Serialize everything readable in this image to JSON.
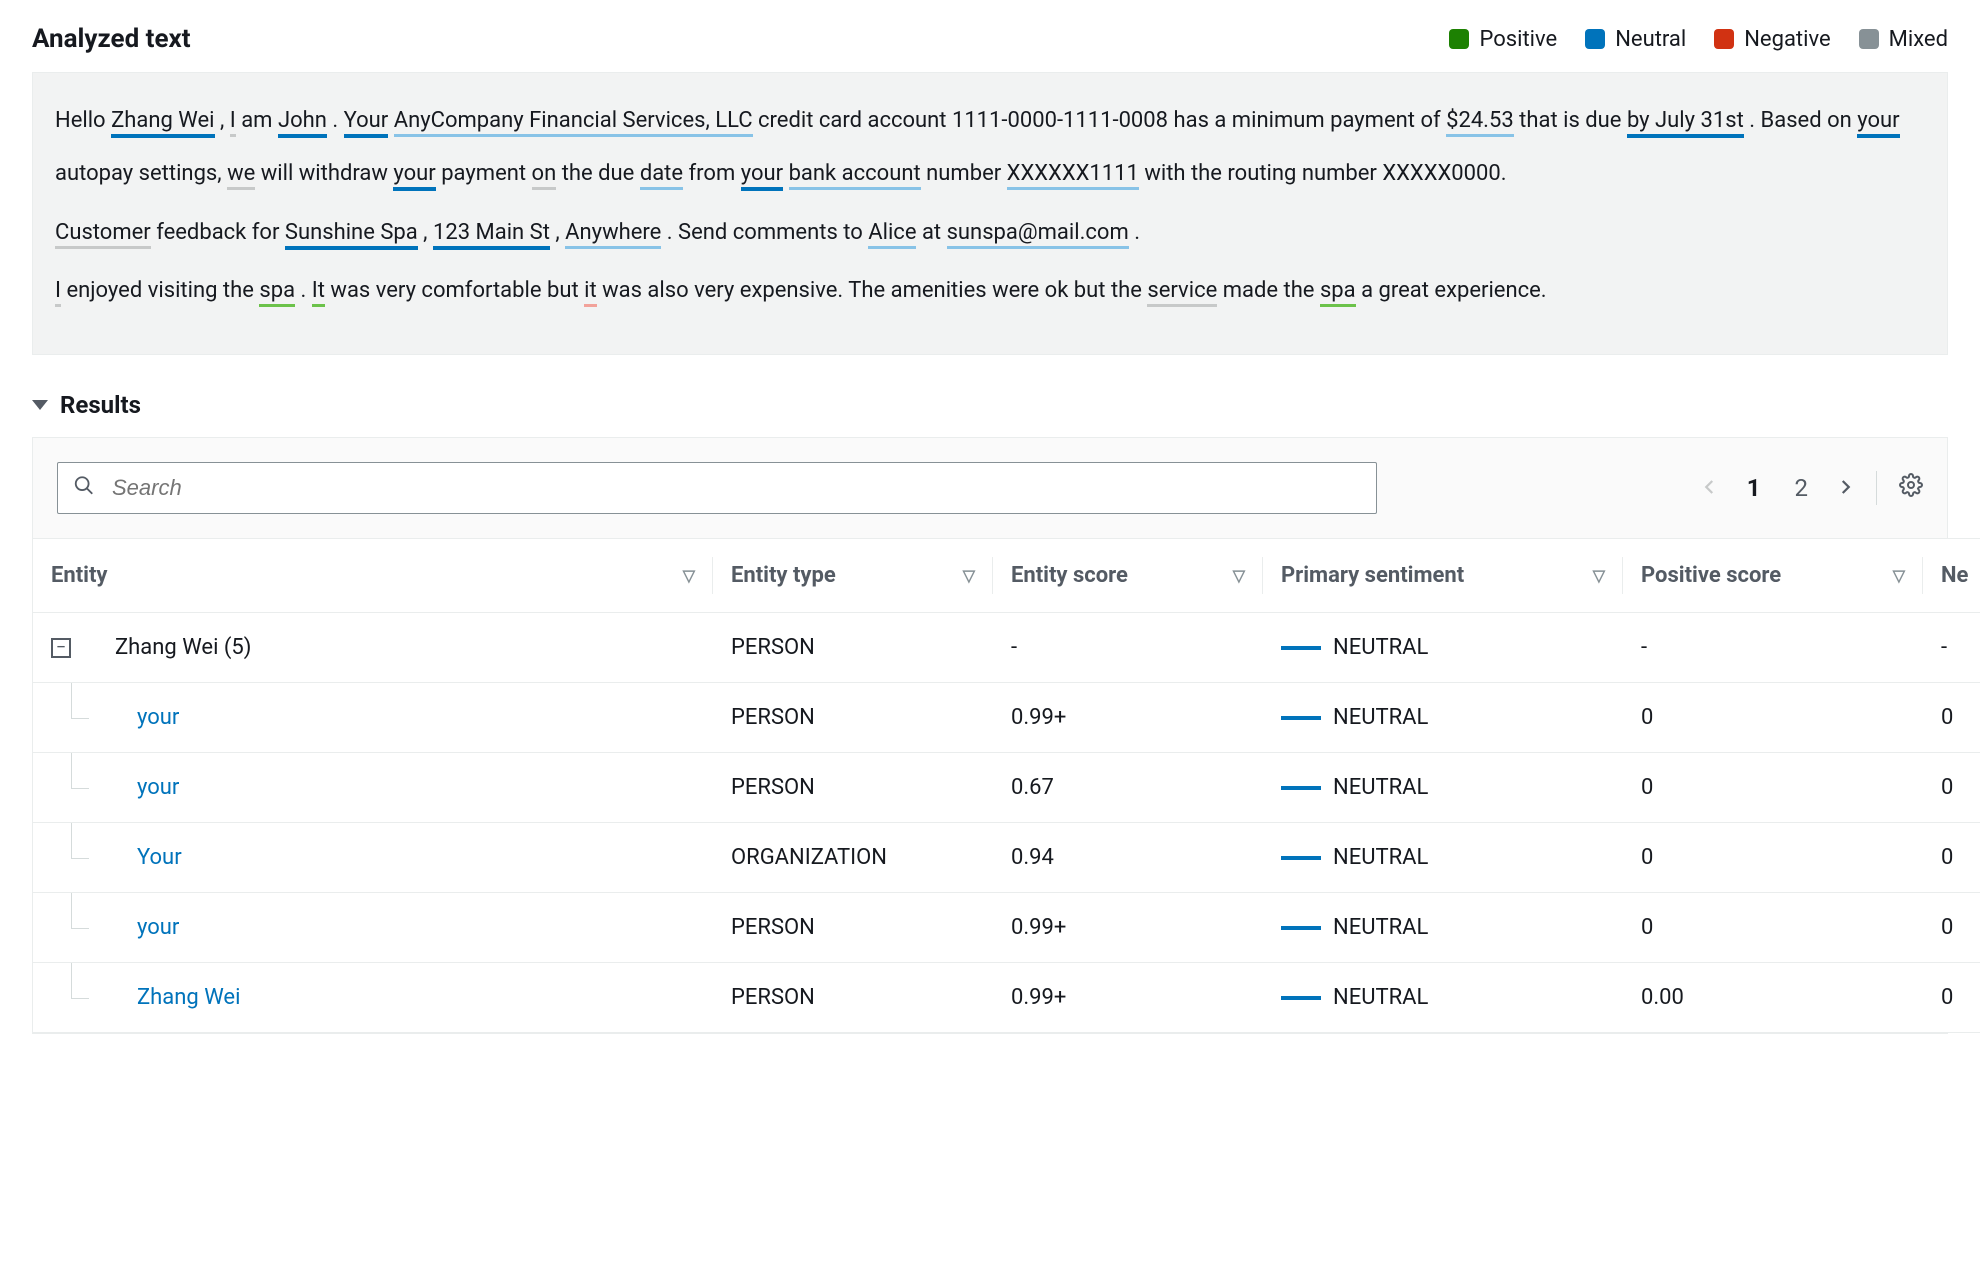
{
  "header": {
    "title": "Analyzed text"
  },
  "legend": {
    "positive": "Positive",
    "neutral": "Neutral",
    "negative": "Negative",
    "mixed": "Mixed"
  },
  "analyzed_text": {
    "p1": {
      "t0": "Hello ",
      "zhang_wei": "Zhang Wei",
      "t1": " , ",
      "i1": "I",
      "t2": " am ",
      "john": "John",
      "t3": " . ",
      "your1": "Your",
      "t4": "  ",
      "company": "AnyCompany Financial Services, LLC",
      "t5": "  credit card account  1111-0000-1111-0008 has a minimum payment of ",
      "amount": "$24.53",
      "t6": "  that is due ",
      "due": "by July 31st",
      "t7": " . Based on ",
      "your2": "your",
      "t8": "  autopay settings, ",
      "we1": "we",
      "t9": "  will withdraw ",
      "your3": "your",
      "t10": "  payment ",
      "on1": "on",
      "t11": "  the due ",
      "date1": "date",
      "t12": "  from ",
      "your4": "your",
      "t13": "  ",
      "bank_account": "bank account",
      "t14": "  number ",
      "acct_num": "XXXXXX1111",
      "t15": "  with the routing number XXXXX0000."
    },
    "p2": {
      "customer": "Customer",
      "t0": "  feedback for ",
      "spa_name": "Sunshine Spa",
      "t1": " , ",
      "addr": "123 Main St",
      "t2": " , ",
      "city": "Anywhere",
      "t3": " . Send comments to ",
      "alice": "Alice",
      "t4": "  at ",
      "email": "sunspa@mail.com",
      "t5": " ."
    },
    "p3": {
      "i1": "I",
      "t0": "  enjoyed visiting the ",
      "spa1": "spa",
      "t1": " . ",
      "it1": "It",
      "t2": "  was very comfortable but ",
      "it2": "it",
      "t3": "  was also very expensive. The amenities were ok but the ",
      "service": "service",
      "t4": "  made the ",
      "spa2": "spa",
      "t5": "  a great experience."
    }
  },
  "results": {
    "heading": "Results",
    "search_placeholder": "Search",
    "pager": {
      "page1": "1",
      "page2": "2"
    },
    "columns": {
      "entity": "Entity",
      "entity_type": "Entity type",
      "entity_score": "Entity score",
      "primary_sentiment": "Primary sentiment",
      "positive_score": "Positive score",
      "negative_score_abbrev": "Ne"
    },
    "rows": [
      {
        "indent": 0,
        "expand": "−",
        "entity": "Zhang Wei (5)",
        "link": false,
        "type": "PERSON",
        "score": "-",
        "sentiment": "NEUTRAL",
        "positive": "-",
        "negative": "-"
      },
      {
        "indent": 1,
        "entity": "your",
        "link": true,
        "type": "PERSON",
        "score": "0.99+",
        "sentiment": "NEUTRAL",
        "positive": "0",
        "negative": "0"
      },
      {
        "indent": 1,
        "entity": "your",
        "link": true,
        "type": "PERSON",
        "score": "0.67",
        "sentiment": "NEUTRAL",
        "positive": "0",
        "negative": "0"
      },
      {
        "indent": 1,
        "entity": "Your",
        "link": true,
        "type": "ORGANIZATION",
        "score": "0.94",
        "sentiment": "NEUTRAL",
        "positive": "0",
        "negative": "0"
      },
      {
        "indent": 1,
        "entity": "your",
        "link": true,
        "type": "PERSON",
        "score": "0.99+",
        "sentiment": "NEUTRAL",
        "positive": "0",
        "negative": "0"
      },
      {
        "indent": 1,
        "last": true,
        "entity": "Zhang Wei",
        "link": true,
        "type": "PERSON",
        "score": "0.99+",
        "sentiment": "NEUTRAL",
        "positive": "0.00",
        "negative": "0"
      }
    ]
  }
}
